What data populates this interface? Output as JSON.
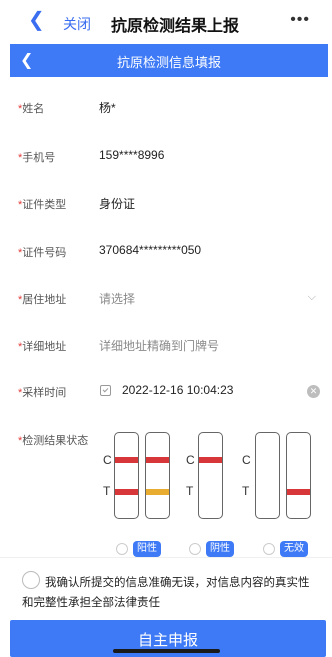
{
  "topbar": {
    "back_icon": "chevron-left-icon",
    "close_label": "关闭",
    "title": "抗原检测结果上报",
    "more_label": "•••"
  },
  "navbar": {
    "back_icon": "chevron-left-icon",
    "title": "抗原检测信息填报"
  },
  "required_mark": "*",
  "form": {
    "name": {
      "label": "姓名",
      "value": "杨*"
    },
    "phone": {
      "label": "手机号",
      "value": "159****8996"
    },
    "id_type": {
      "label": "证件类型",
      "value": "身份证"
    },
    "id_number": {
      "label": "证件号码",
      "value": "370684*********050"
    },
    "residence": {
      "label": "居住地址",
      "placeholder": "请选择"
    },
    "address": {
      "label": "详细地址",
      "placeholder": "详细地址精确到门牌号"
    },
    "sample_time": {
      "label": "采样时间",
      "value": "2022-12-16 10:04:23"
    },
    "result": {
      "label": "检测结果状态"
    }
  },
  "test_strip": {
    "c_label": "C",
    "t_label": "T",
    "colors": {
      "red": "#d8373a",
      "yellow": "#e8ac30",
      "blue": "#3e7af5"
    }
  },
  "result_options": [
    {
      "label": "阳性"
    },
    {
      "label": "阴性"
    },
    {
      "label": "无效"
    }
  ],
  "confirm_text": "我确认所提交的信息准确无误，对信息内容的真实性和完整性承担全部法律责任",
  "submit_label": "自主申报"
}
